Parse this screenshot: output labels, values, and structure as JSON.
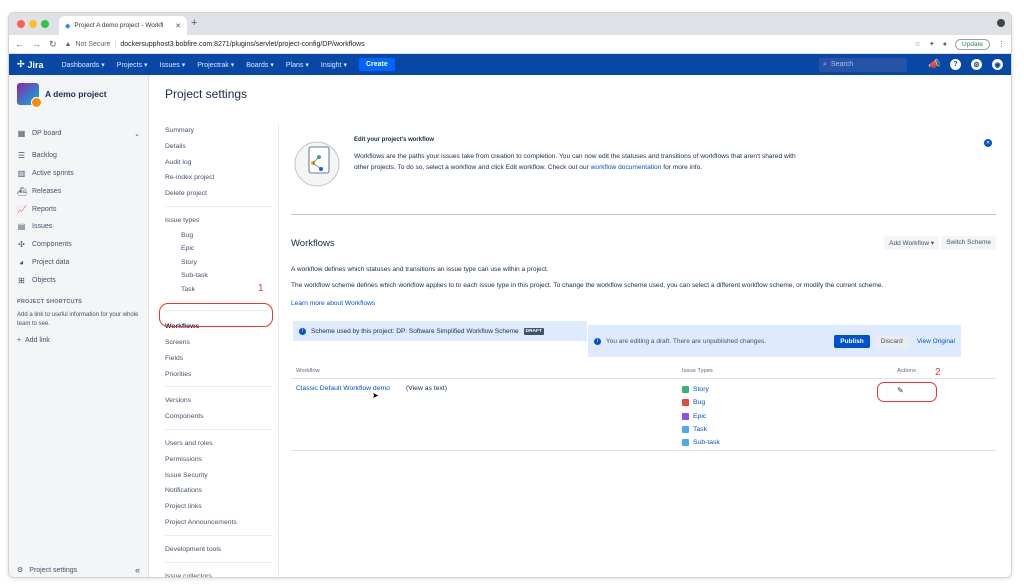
{
  "browser": {
    "tab_title": "Project A demo project - Workfl",
    "new_tab": "+",
    "not_secure": "Not Secure",
    "url": "dockersupphost3.bobfire.com:8271/plugins/servlet/project-config/DP/workflows",
    "update_label": "Update"
  },
  "nav": {
    "logo": "Jira",
    "items": [
      "Dashboards",
      "Projects",
      "Issues",
      "Projectrak",
      "Boards",
      "Plans",
      "Insight"
    ],
    "create": "Create",
    "search_placeholder": "Search"
  },
  "sidebar": {
    "project_name": "A demo project",
    "board": "DP board",
    "items": [
      "Backlog",
      "Active sprints",
      "Releases",
      "Reports",
      "Issues",
      "Components",
      "Project data",
      "Objects"
    ],
    "shortcuts_heading": "PROJECT SHORTCUTS",
    "shortcuts_text": "Add a link to useful information for your whole team to see.",
    "add_link": "Add link",
    "footer": "Project settings"
  },
  "settings": {
    "title": "Project settings",
    "group1": [
      "Summary",
      "Details",
      "Audit log",
      "Re-index project",
      "Delete project"
    ],
    "issue_types_label": "Issue types",
    "issue_types": [
      "Bug",
      "Epic",
      "Story",
      "Sub-task",
      "Task"
    ],
    "group2": [
      "Workflows",
      "Screens",
      "Fields",
      "Priorities"
    ],
    "group3": [
      "Versions",
      "Components"
    ],
    "group4": [
      "Users and roles",
      "Permissions",
      "Issue Security",
      "Notifications",
      "Project links",
      "Project Announcements"
    ],
    "group5": [
      "Development tools"
    ],
    "group6": [
      "Issue collectors"
    ]
  },
  "annotations": {
    "one": "1",
    "two": "2"
  },
  "banner": {
    "title": "Edit your project's workflow",
    "text": "Workflows are the paths your issues take from creation to completion. You can now edit the statuses and transitions of workflows that aren't shared with other projects. To do so, select a workflow and click Edit workflow. Check out our",
    "link": "workflow documentation",
    "tail": "for more info."
  },
  "workflows": {
    "title": "Workflows",
    "add_workflow": "Add Workflow",
    "switch_scheme": "Switch Scheme",
    "desc1": "A workflow defines which statuses and transitions an issue type can use within a project.",
    "desc2": "The workflow scheme defines which workflow applies to to each issue type in this project. To change the workflow scheme used, you can select a different workflow scheme, or modify the current scheme.",
    "learn_more": "Learn more about Workflows",
    "scheme_text": "Scheme used by this project: DP: Software Simplified Workflow Scheme",
    "draft_label": "DRAFT",
    "draft_notice": "You are editing a draft. There are unpublished changes.",
    "publish": "Publish",
    "discard": "Discard",
    "view_original": "View Original",
    "columns": [
      "Workflow",
      "Issue Types",
      "Actions"
    ],
    "row": {
      "name": "Classic Default Workflow demo",
      "view_as_text": "(View as text)",
      "issue_types": [
        {
          "name": "Story",
          "color": "#36b37e"
        },
        {
          "name": "Bug",
          "color": "#e5493a"
        },
        {
          "name": "Epic",
          "color": "#904ee2"
        },
        {
          "name": "Task",
          "color": "#4bade8"
        },
        {
          "name": "Sub-task",
          "color": "#4bade8"
        }
      ]
    }
  },
  "colors": {
    "nav": "#0747a6",
    "link": "#0052cc",
    "annotation": "#e53935"
  }
}
